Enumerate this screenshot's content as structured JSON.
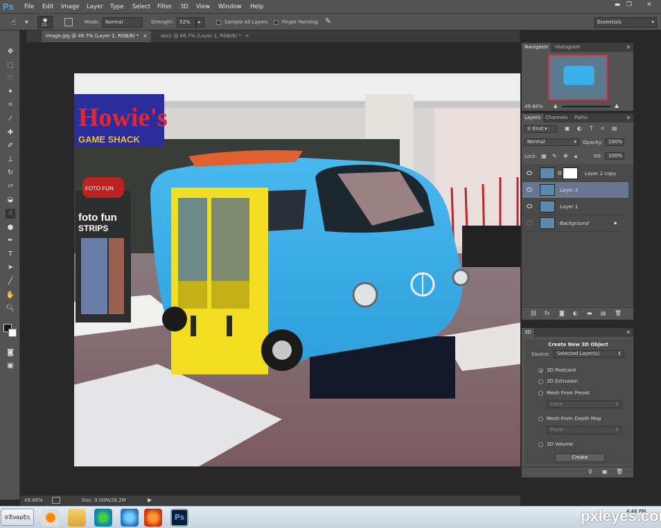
{
  "app": {
    "logo": "Ps"
  },
  "menu": [
    "File",
    "Edit",
    "Image",
    "Layer",
    "Type",
    "Select",
    "Filter",
    "3D",
    "View",
    "Window",
    "Help"
  ],
  "options": {
    "brush_size": "15",
    "mode_label": "Mode:",
    "mode_value": "Normal",
    "strength_label": "Strength:",
    "strength_value": "52%",
    "sample_all": "Sample All Layers",
    "finger_painting": "Finger Painting",
    "workspace": "Essentials"
  },
  "tabs": [
    {
      "label": "image.jpg @ 49.7% (Layer 2, RGB/8) *",
      "active": true
    },
    {
      "label": "sbs1 @ 66.7% (Layer 1, RGB/8) *",
      "active": false
    }
  ],
  "status": {
    "zoom": "49.66%",
    "doc": "Doc: 9.00M/26.2M"
  },
  "navigator": {
    "tabs": [
      "Navigator",
      "Histogram"
    ],
    "zoom": "49.66%"
  },
  "layers_panel": {
    "tabs": [
      "Layers",
      "Channels",
      "Paths"
    ],
    "kind": "Kind",
    "blend": "Normal",
    "opacity_label": "Opacity:",
    "opacity": "100%",
    "lock_label": "Lock:",
    "fill_label": "Fill:",
    "fill": "100%",
    "layers": [
      {
        "name": "Layer 2 copy",
        "visible": true,
        "selected": false
      },
      {
        "name": "Layer 2",
        "visible": true,
        "selected": true
      },
      {
        "name": "Layer 1",
        "visible": true,
        "selected": false
      },
      {
        "name": "Background",
        "visible": false,
        "selected": false,
        "locked": true
      }
    ]
  },
  "panel3d": {
    "tab": "3D",
    "title": "Create New 3D Object",
    "source_label": "Source:",
    "source_value": "Selected Layer(s)",
    "options": [
      {
        "label": "3D Postcard",
        "selected": true
      },
      {
        "label": "3D Extrusion",
        "selected": false
      },
      {
        "label": "Mesh From Preset",
        "selected": false
      },
      {
        "label": "Mesh From Depth Map",
        "selected": false
      },
      {
        "label": "3D Volume",
        "selected": false
      }
    ],
    "preset_value": "Cone",
    "depth_value": "Plane",
    "create_button": "Create"
  },
  "taskbar": {
    "start_label": "Έναρξη",
    "time": "4:46 PM"
  },
  "canvas_text": {
    "sign": "Howie's",
    "sign_sub": "GAME SHACK",
    "booth_top": "FOTO FUN",
    "booth_main": "foto fun",
    "booth_strips": "STRIPS"
  },
  "watermark": "pxleyes.com"
}
